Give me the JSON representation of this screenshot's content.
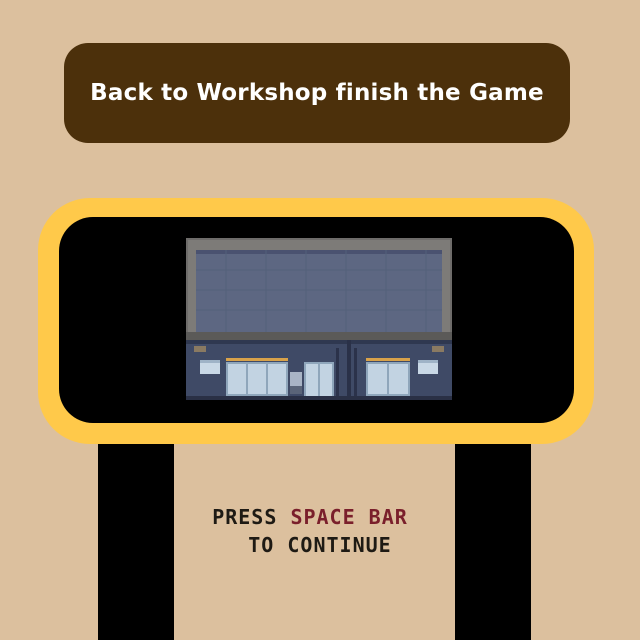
{
  "banner": {
    "title": "Back to Workshop finish the Game"
  },
  "scene": {
    "icon": "building-facade-icon"
  },
  "prompt": {
    "line1_before": "PRESS ",
    "line1_highlight": "SPACE BAR",
    "line2": "TO CONTINUE"
  },
  "colors": {
    "background": "#dcc09e",
    "banner": "#4c300b",
    "frame": "#ffc94a",
    "screen": "#000000",
    "highlight": "#7a1f2b",
    "text": "#1e1a14"
  }
}
